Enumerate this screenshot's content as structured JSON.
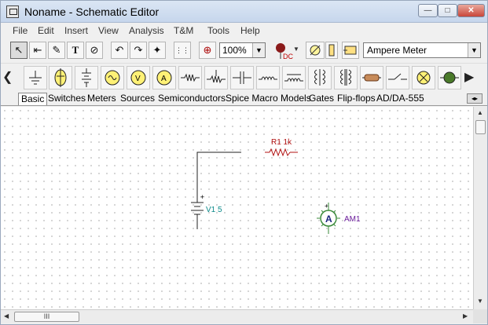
{
  "window": {
    "title": "Noname - Schematic Editor",
    "controls": {
      "minimize": "—",
      "maximize": "□",
      "close": "✕"
    }
  },
  "menu": {
    "items": [
      "File",
      "Edit",
      "Insert",
      "View",
      "Analysis",
      "T&M",
      "Tools",
      "Help"
    ]
  },
  "toolbar": {
    "zoom_value": "100%",
    "dc_label": "DC",
    "component_value": "Ampere Meter",
    "buttons": [
      {
        "name": "select-arrow-icon",
        "glyph": "↖"
      },
      {
        "name": "wire-icon",
        "glyph": "⇤"
      },
      {
        "name": "pencil-icon",
        "glyph": "✎"
      },
      {
        "name": "text-icon",
        "glyph": "T"
      },
      {
        "name": "line-text-icon",
        "glyph": "⊘"
      },
      {
        "name": "undo-icon",
        "glyph": "↶"
      },
      {
        "name": "redo-icon",
        "glyph": "↷"
      },
      {
        "name": "node-icon",
        "glyph": "✦"
      },
      {
        "name": "grid-icon",
        "glyph": "⋮⋮"
      },
      {
        "name": "zoom-icon",
        "glyph": "⊕"
      }
    ]
  },
  "palette": {
    "items": [
      "ground-icon",
      "battery-source-icon",
      "multi-battery-icon",
      "voltage-generator-icon",
      "voltmeter-icon",
      "ammeter-icon",
      "resistor-icon",
      "potentiometer-icon",
      "capacitor-icon",
      "inductor-icon",
      "inductor-core-icon",
      "transformer-icon",
      "transformer-ct-icon",
      "relay-icon",
      "switch-icon",
      "lamp-icon",
      "motor-icon"
    ]
  },
  "tabs": {
    "items": [
      "Basic",
      "Switches",
      "Meters",
      "Sources",
      "Semiconductors",
      "Spice Macro Models",
      "Gates",
      "Flip-flops",
      "AD/DA-555"
    ],
    "active": "Basic"
  },
  "schematic": {
    "resistor": {
      "label": "R1 1k"
    },
    "source": {
      "label": "V1 5",
      "plus": "+"
    },
    "ammeter": {
      "label": "AM1",
      "symbol": "A",
      "plus": "+"
    }
  },
  "scroll": {
    "h_thumb": "III"
  },
  "colors": {
    "resistor_label": "#b01010",
    "source_label": "#0a8a8a",
    "ammeter_label": "#6a1b9a",
    "ammeter_ring": "#3a8a3a"
  }
}
